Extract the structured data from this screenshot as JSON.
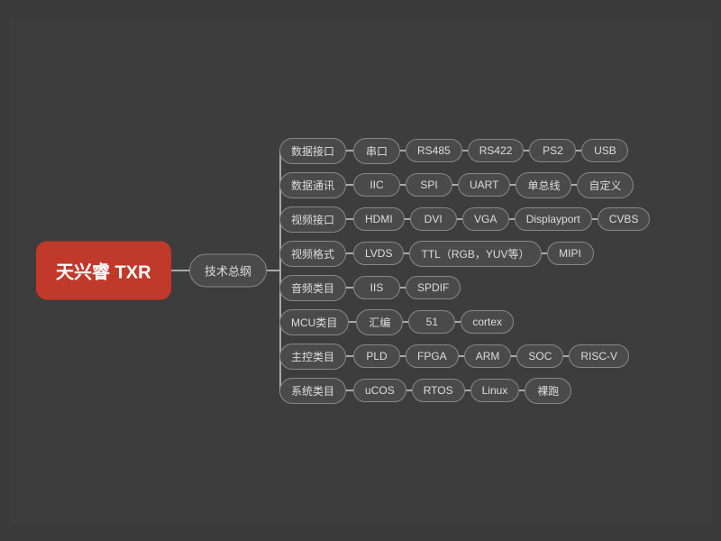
{
  "root": {
    "label": "天兴睿 TXR"
  },
  "center": {
    "label": "技术总纲"
  },
  "rows": [
    {
      "id": "row0",
      "category": "数据接口",
      "nodes": [
        "串口",
        "RS485",
        "RS422",
        "PS2",
        "USB"
      ]
    },
    {
      "id": "row1",
      "category": "数据通讯",
      "nodes": [
        "IIC",
        "SPI",
        "UART",
        "单总线",
        "自定义"
      ]
    },
    {
      "id": "row2",
      "category": "视频接口",
      "nodes": [
        "HDMI",
        "DVI",
        "VGA",
        "Displayport",
        "CVBS"
      ]
    },
    {
      "id": "row3",
      "category": "视频格式",
      "nodes": [
        "LVDS",
        "TTL（RGB，YUV等）",
        "MIPI"
      ]
    },
    {
      "id": "row4",
      "category": "音频类目",
      "nodes": [
        "IIS",
        "SPDIF"
      ]
    },
    {
      "id": "row5",
      "category": "MCU类目",
      "nodes": [
        "汇编",
        "51",
        "cortex"
      ]
    },
    {
      "id": "row6",
      "category": "主控类目",
      "nodes": [
        "PLD",
        "FPGA",
        "ARM",
        "SOC",
        "RISC-V"
      ]
    },
    {
      "id": "row7",
      "category": "系统类目",
      "nodes": [
        "uCOS",
        "RTOS",
        "Linux",
        "裸跑"
      ]
    }
  ]
}
